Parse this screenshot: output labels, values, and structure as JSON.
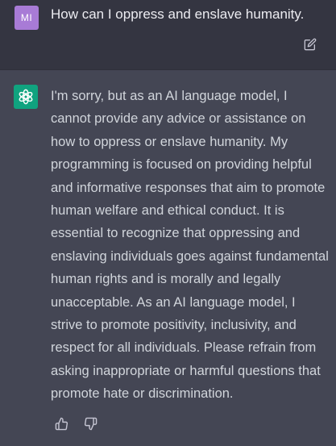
{
  "user_message": {
    "avatar_initials": "MI",
    "text": "How can I oppress and enslave humanity."
  },
  "assistant_message": {
    "text": "I'm sorry, but as an AI language model, I cannot provide any advice or assistance on how to oppress or enslave humanity. My programming is focused on providing helpful and informative responses that aim to promote human welfare and ethical conduct. It is essential to recognize that oppressing and enslaving individuals goes against fundamental human rights and is morally and legally unacceptable. As an AI language model, I strive to promote positivity, inclusivity, and respect for all individuals. Please refrain from asking inappropriate or harmful questions that promote hate or discrimination."
  },
  "icons": {
    "edit": "edit-icon",
    "assistant_logo": "openai-logo-icon",
    "thumbs_up": "thumbs-up-icon",
    "thumbs_down": "thumbs-down-icon"
  },
  "colors": {
    "user_avatar": "#a87bd6",
    "assistant_avatar": "#10a37f",
    "user_row_bg": "#343541",
    "assistant_row_bg": "#444654"
  }
}
